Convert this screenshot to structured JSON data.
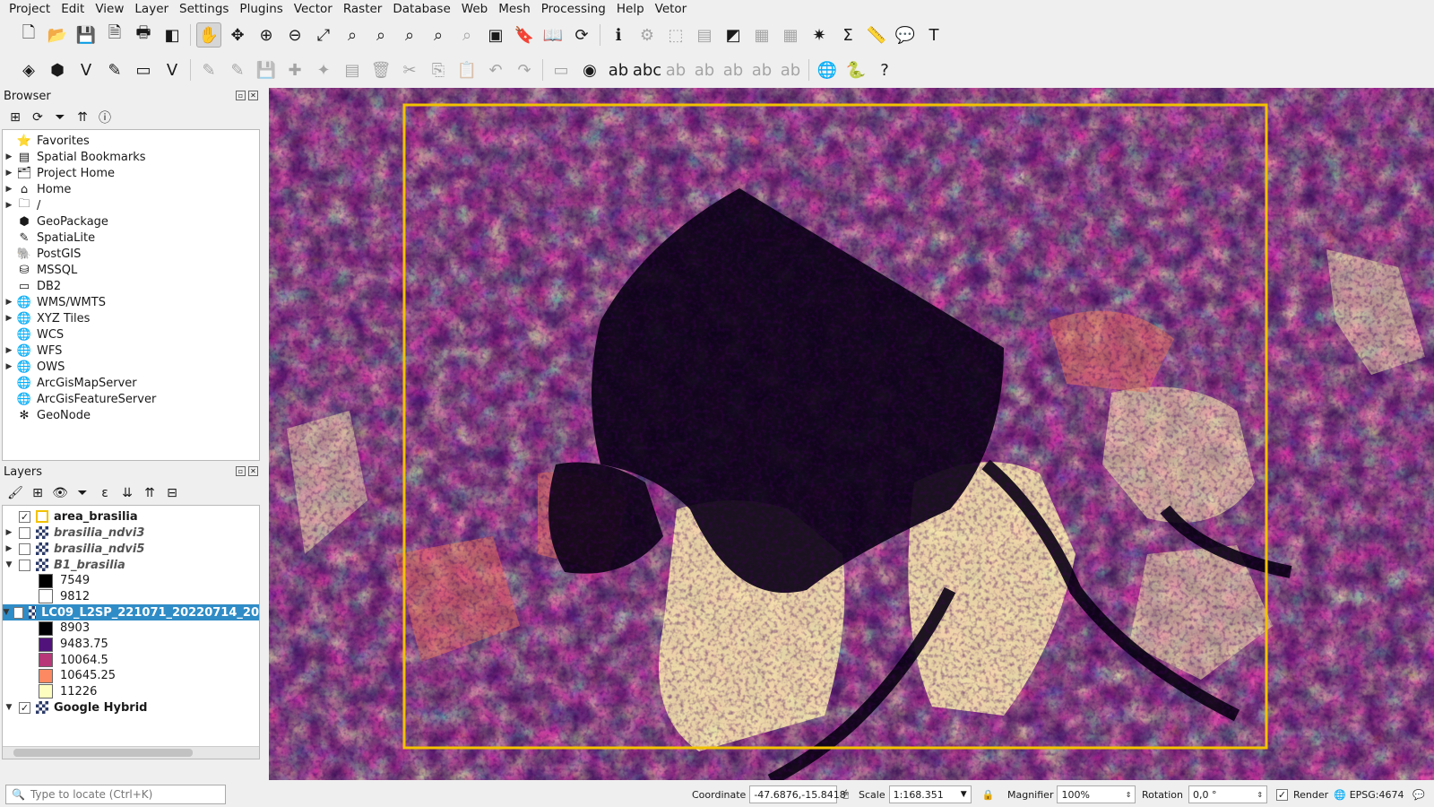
{
  "menubar": [
    "Project",
    "Edit",
    "View",
    "Layer",
    "Settings",
    "Plugins",
    "Vector",
    "Raster",
    "Database",
    "Web",
    "Mesh",
    "Processing",
    "Help",
    "Vetor"
  ],
  "browser": {
    "title": "Browser",
    "items": [
      {
        "label": "Favorites",
        "icon": "star-icon",
        "expandable": false
      },
      {
        "label": "Spatial Bookmarks",
        "icon": "bookmark-icon",
        "expandable": true
      },
      {
        "label": "Project Home",
        "icon": "project-home-icon",
        "expandable": true
      },
      {
        "label": "Home",
        "icon": "home-icon",
        "expandable": true
      },
      {
        "label": "/",
        "icon": "folder-icon",
        "expandable": true
      },
      {
        "label": "GeoPackage",
        "icon": "geopackage-icon",
        "expandable": false
      },
      {
        "label": "SpatiaLite",
        "icon": "spatialite-icon",
        "expandable": false
      },
      {
        "label": "PostGIS",
        "icon": "postgis-icon",
        "expandable": false
      },
      {
        "label": "MSSQL",
        "icon": "mssql-icon",
        "expandable": false
      },
      {
        "label": "DB2",
        "icon": "db2-icon",
        "expandable": false
      },
      {
        "label": "WMS/WMTS",
        "icon": "wms-icon",
        "expandable": true
      },
      {
        "label": "XYZ Tiles",
        "icon": "xyz-icon",
        "expandable": true
      },
      {
        "label": "WCS",
        "icon": "wcs-icon",
        "expandable": false
      },
      {
        "label": "WFS",
        "icon": "wfs-icon",
        "expandable": true
      },
      {
        "label": "OWS",
        "icon": "ows-icon",
        "expandable": true
      },
      {
        "label": "ArcGisMapServer",
        "icon": "arcgis-map-icon",
        "expandable": false
      },
      {
        "label": "ArcGisFeatureServer",
        "icon": "arcgis-feature-icon",
        "expandable": false
      },
      {
        "label": "GeoNode",
        "icon": "geonode-icon",
        "expandable": false
      }
    ]
  },
  "layers": {
    "title": "Layers",
    "items": [
      {
        "name": "area_brasilia",
        "checked": true,
        "type": "poly",
        "style": "bold"
      },
      {
        "name": "brasilia_ndvi3",
        "checked": false,
        "type": "raster",
        "style": "ital"
      },
      {
        "name": "brasilia_ndvi5",
        "checked": false,
        "type": "raster",
        "style": "ital"
      },
      {
        "name": "B1_brasilia",
        "checked": false,
        "type": "raster",
        "style": "ital"
      }
    ],
    "b1_legend": [
      {
        "label": "7549",
        "color": "#000000"
      },
      {
        "label": "9812",
        "color": "#ffffff"
      }
    ],
    "lc09": {
      "name": "LC09_L2SP_221071_20220714_20",
      "checked": true
    },
    "lc09_legend": [
      {
        "label": "8903",
        "color": "#000004"
      },
      {
        "label": "9483.75",
        "color": "#51127c"
      },
      {
        "label": "10064.5",
        "color": "#b73779"
      },
      {
        "label": "10645.25",
        "color": "#fc8961"
      },
      {
        "label": "11226",
        "color": "#fcfdbf"
      }
    ],
    "google": {
      "name": "Google Hybrid",
      "checked": true
    }
  },
  "statusbar": {
    "locator_placeholder": "Type to locate (Ctrl+K)",
    "coordinate_label": "Coordinate",
    "coordinate_value": "-47.6876,-15.8418",
    "scale_label": "Scale",
    "scale_value": "1:168.351",
    "magnifier_label": "Magnifier",
    "magnifier_value": "100%",
    "rotation_label": "Rotation",
    "rotation_value": "0,0 °",
    "render_label": "Render",
    "crs": "EPSG:4674"
  },
  "colors": {
    "aoi_outline": "#f2c200",
    "selection": "#308cc6"
  }
}
